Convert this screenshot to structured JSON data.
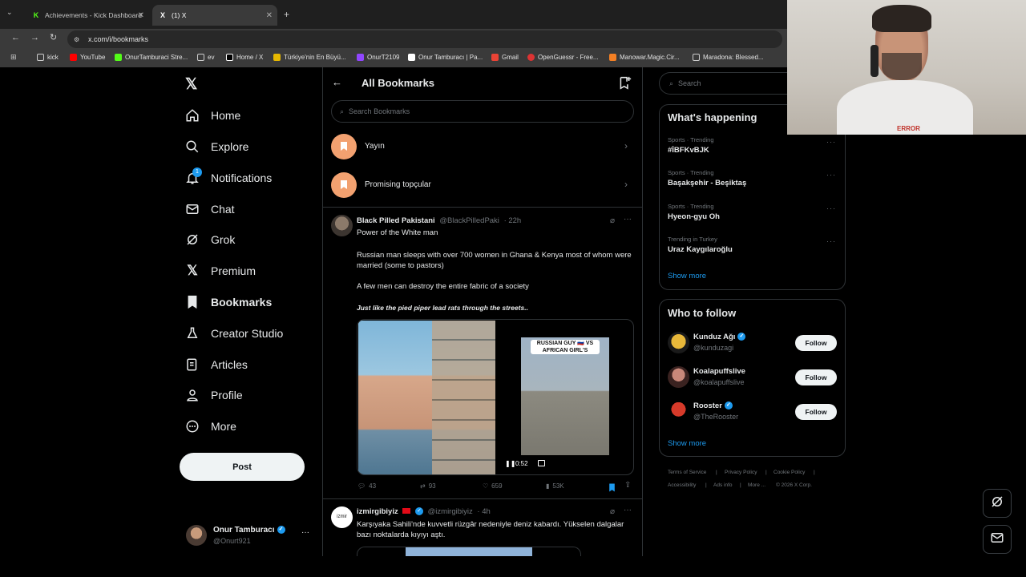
{
  "browser": {
    "tabs": [
      {
        "title": "Achievements - Kick Dashboard",
        "favicon": "K"
      },
      {
        "title": "(1) X",
        "favicon": "X"
      }
    ],
    "url": "x.com/i/bookmarks",
    "bookmarks_bar": [
      "kick",
      "YouTube",
      "OnurTamburaci Stre...",
      "ev",
      "Home / X",
      "Türkiye'nin En Büyü...",
      "OnurT2109",
      "Onur Tamburacı | Pa...",
      "Gmail",
      "OpenGuessr - Free...",
      "Manowar.Magic.Cir...",
      "Maradona: Blessed..."
    ]
  },
  "nav": {
    "items": [
      "Home",
      "Explore",
      "Notifications",
      "Chat",
      "Grok",
      "Premium",
      "Bookmarks",
      "Creator Studio",
      "Articles",
      "Profile",
      "More"
    ],
    "notification_badge": "1",
    "post_label": "Post",
    "account": {
      "name": "Onur Tamburacı",
      "handle": "@Onurt921"
    }
  },
  "header": {
    "title": "All Bookmarks",
    "search_placeholder": "Search Bookmarks"
  },
  "folders": [
    "Yayın",
    "Promising topçular"
  ],
  "tweet1": {
    "name": "Black Pilled Pakistani",
    "handle": "@BlackPilledPaki",
    "time": "· 22h",
    "line1": "Power of the White man",
    "line2": "Russian man sleeps with over 700 women in Ghana & Kenya most of whom were married (some to pastors)",
    "line3": "A few men can destroy the entire fabric of a society",
    "line4": "Just like the pied piper lead rats through the streets..",
    "video_caption": "RUSSIAN GUY 🇷🇺 VS AFRICAN GIRL'S",
    "video_time": "0:52",
    "replies": "43",
    "reposts": "93",
    "likes": "659",
    "views": "53K"
  },
  "tweet2": {
    "name": "izmirgibiyiz",
    "handle": "@izmirgibiyiz",
    "time": "· 4h",
    "text": "Karşıyaka Sahili'nde kuvvetli rüzgâr nedeniyle deniz kabardı. Yükselen dalgalar bazı noktalarda kıyıyı aştı."
  },
  "right": {
    "search_placeholder": "Search",
    "happening_title": "What's happening",
    "trends": [
      {
        "meta": "Sports · Trending",
        "name": "#İBFKvBJK"
      },
      {
        "meta": "Sports · Trending",
        "name": "Başakşehir - Beşiktaş"
      },
      {
        "meta": "Sports · Trending",
        "name": "Hyeon-gyu Oh"
      },
      {
        "meta": "Trending in Turkey",
        "name": "Uraz Kaygılaroğlu"
      }
    ],
    "show_more": "Show more",
    "who_title": "Who to follow",
    "follow": [
      {
        "name": "Kunduz Ağı",
        "handle": "@kunduzagi",
        "btn": "Follow"
      },
      {
        "name": "Koalapuffslive",
        "handle": "@koalapuffslive",
        "btn": "Follow"
      },
      {
        "name": "Rooster",
        "handle": "@TheRooster",
        "btn": "Follow"
      }
    ],
    "show_more2": "Show more",
    "footer": [
      "Terms of Service",
      "|",
      "Privacy Policy",
      "|",
      "Cookie Policy",
      "|",
      "Accessibility",
      "|",
      "Ads info",
      "|",
      "More ...",
      "© 2026 X Corp."
    ]
  },
  "webcam_shirt_text": "ERROR",
  "colors": {
    "accent": "#1d9bf0",
    "folder": "#f2a170",
    "background": "#000000"
  }
}
